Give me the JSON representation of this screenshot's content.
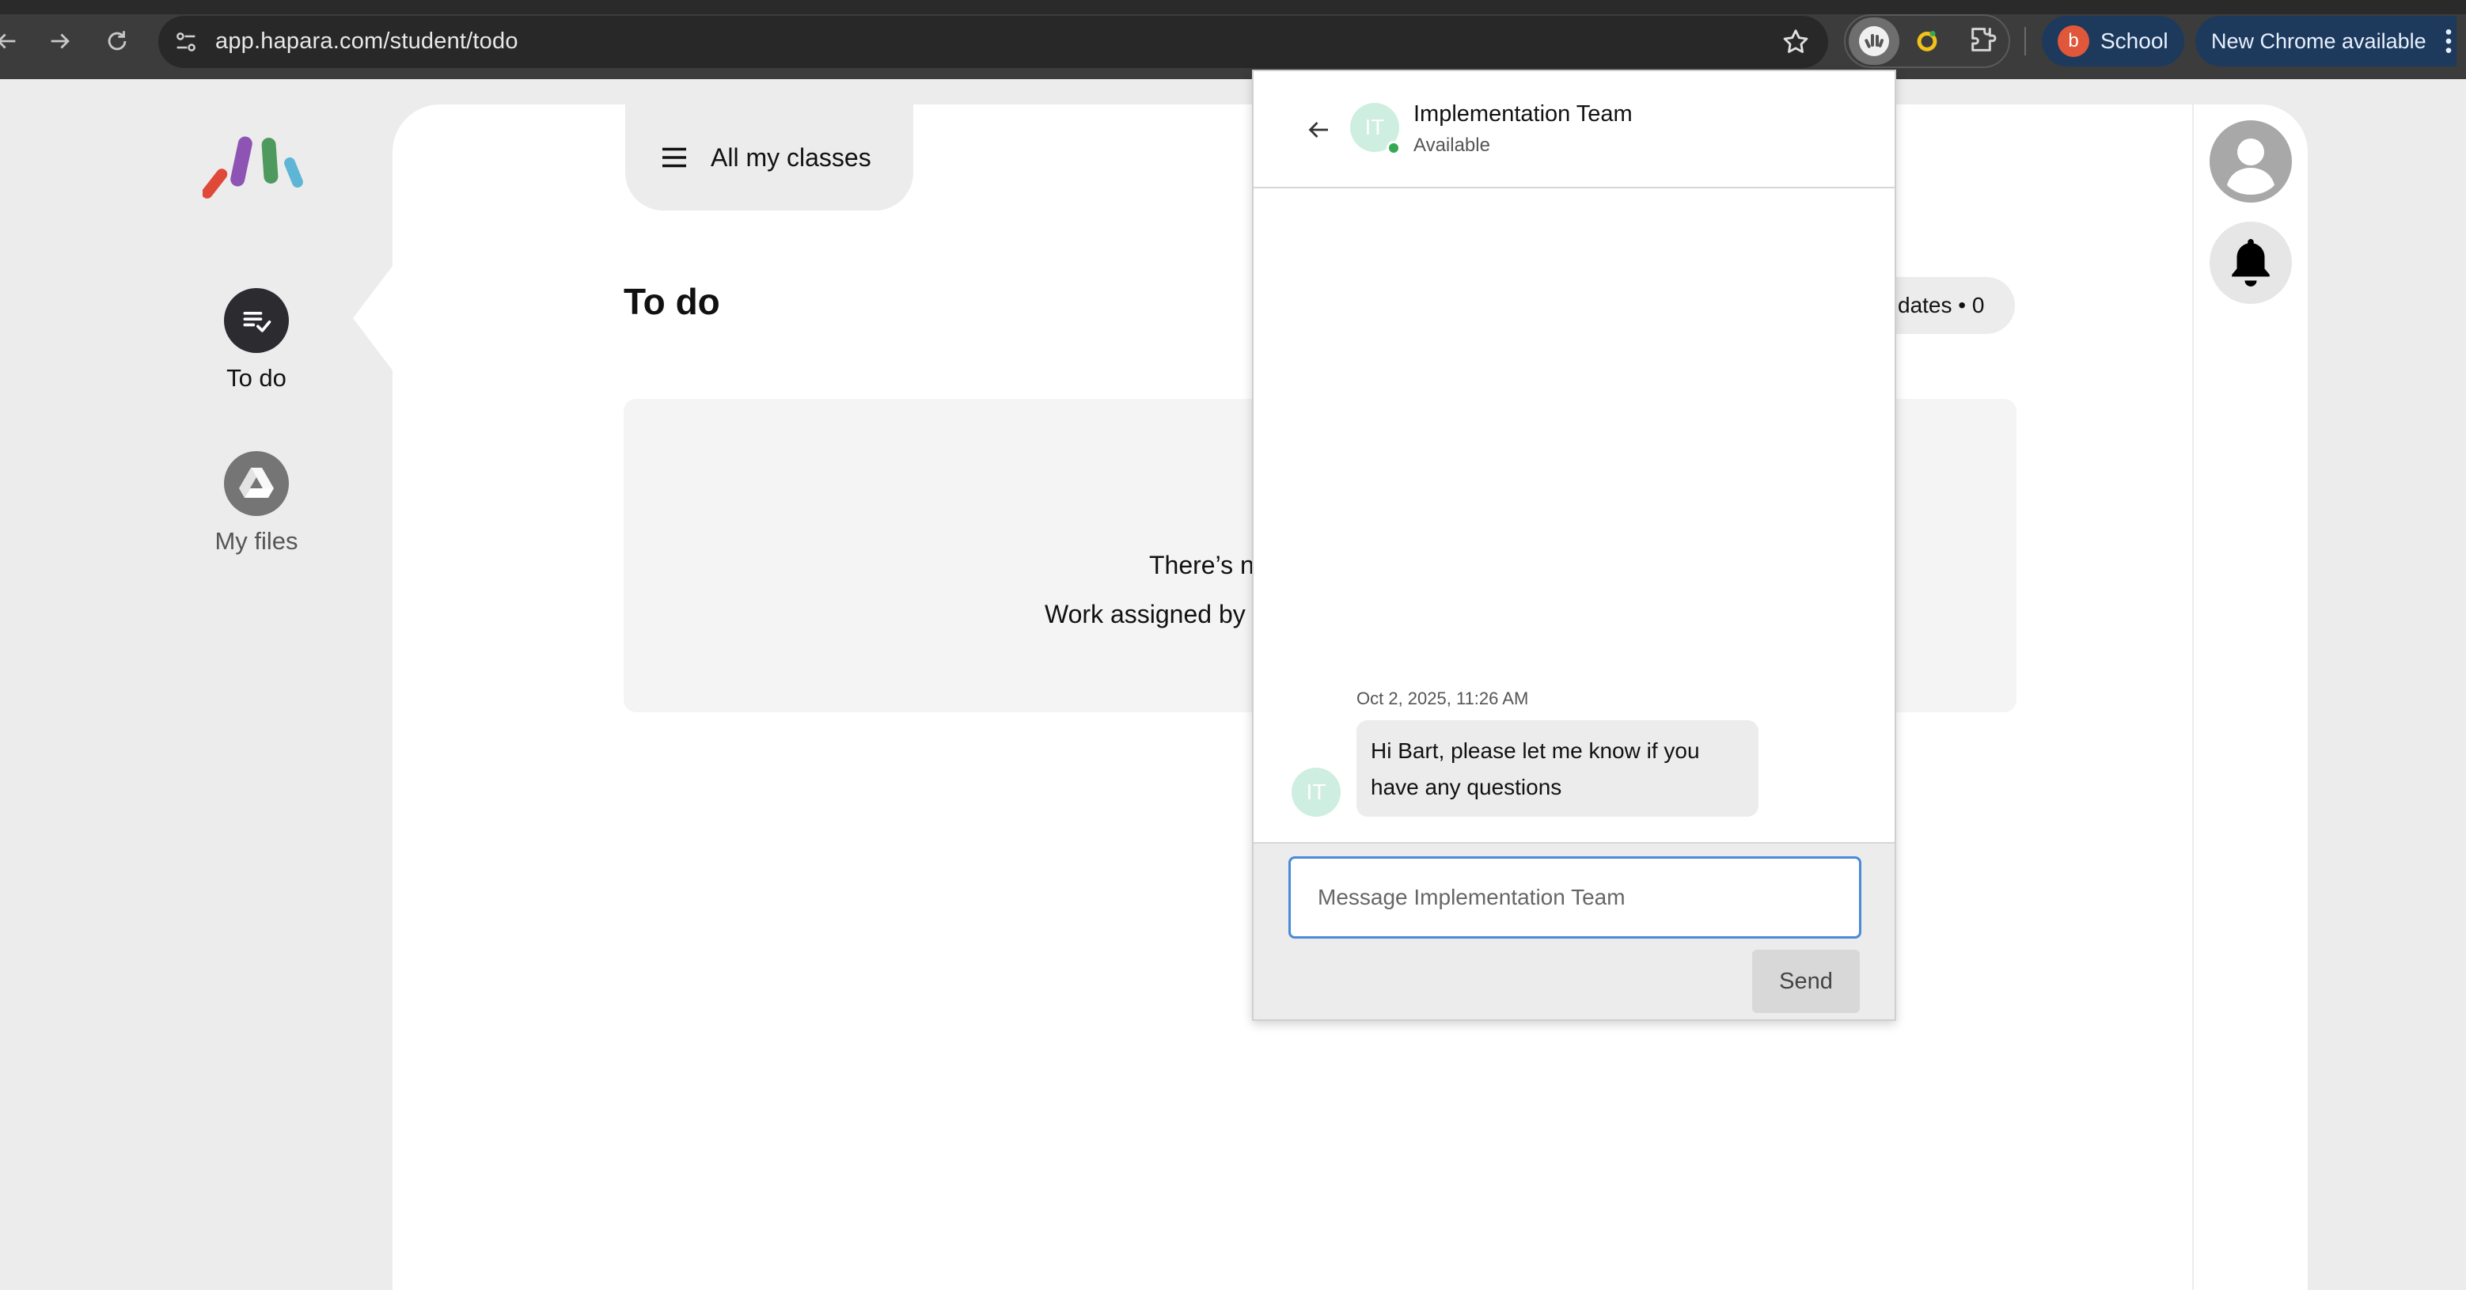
{
  "browser": {
    "url": "app.hapara.com/student/todo",
    "profile_initial": "b",
    "profile_name": "School",
    "update_label": "New Chrome available",
    "icons": {
      "back": "back-arrow-icon",
      "forward": "forward-arrow-icon",
      "reload": "reload-icon",
      "site_info": "tune-icon",
      "bookmark": "star-icon",
      "hapara_ext": "hapara-extension-icon",
      "ring_ext": "ring-extension-icon",
      "extensions": "puzzle-icon",
      "menu": "more-vertical-icon"
    },
    "colors": {
      "chip_bg": "#1d3a5c",
      "profile_avatar": "#e0573a"
    }
  },
  "sidebar": {
    "items": [
      {
        "label": "To do",
        "icon": "todo-list-check-icon",
        "active": true
      },
      {
        "label": "My files",
        "icon": "google-drive-icon",
        "active": false
      }
    ]
  },
  "header": {
    "classes_label": "All my classes",
    "page_title": "To do",
    "updates_label": "dates • 0"
  },
  "empty_state": {
    "title": "There’s n",
    "subtitle": "Work assigned by y"
  },
  "right_rail": {
    "icons": [
      "user-avatar-icon",
      "bell-icon"
    ]
  },
  "chat": {
    "contact_initials": "IT",
    "contact_name": "Implementation Team",
    "contact_status": "Available",
    "messages": [
      {
        "timestamp": "Oct 2, 2025, 11:26 AM",
        "sender_initials": "IT",
        "text": "Hi Bart, please let me know if you have any questions"
      }
    ],
    "input_placeholder": "Message Implementation Team",
    "send_label": "Send",
    "colors": {
      "avatar_bg": "#cdeee0",
      "presence": "#34a853",
      "input_border": "#4a8ad8"
    }
  }
}
